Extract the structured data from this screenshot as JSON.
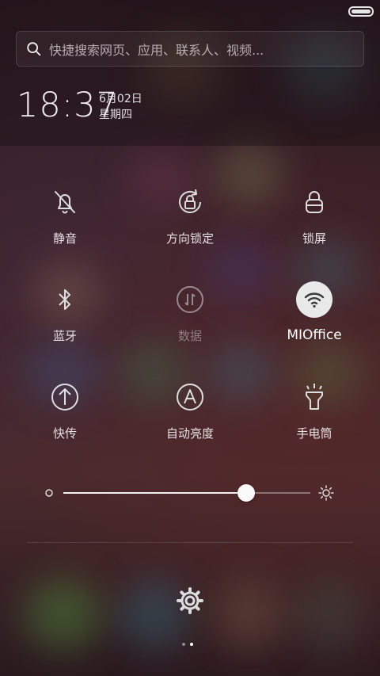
{
  "search": {
    "placeholder": "快捷搜索网页、应用、联系人、视频..."
  },
  "clock": {
    "time": "18:37",
    "date": "6月02日",
    "weekday": "星期四"
  },
  "toggles": [
    {
      "label": "静音",
      "icon": "bell-muted-icon",
      "active": false,
      "dim": false
    },
    {
      "label": "方向锁定",
      "icon": "rotation-lock-icon",
      "active": false,
      "dim": false
    },
    {
      "label": "锁屏",
      "icon": "lock-icon",
      "active": false,
      "dim": false
    },
    {
      "label": "蓝牙",
      "icon": "bluetooth-icon",
      "active": false,
      "dim": false
    },
    {
      "label": "数据",
      "icon": "mobile-data-icon",
      "active": false,
      "dim": true
    },
    {
      "label": "MIOffice",
      "icon": "wifi-icon",
      "active": true,
      "dim": false
    },
    {
      "label": "快传",
      "icon": "quick-transfer-icon",
      "active": false,
      "dim": false
    },
    {
      "label": "自动亮度",
      "icon": "auto-brightness-icon",
      "active": false,
      "dim": false
    },
    {
      "label": "手电筒",
      "icon": "flashlight-icon",
      "active": false,
      "dim": false
    }
  ],
  "brightness": {
    "level": 0.74
  },
  "pager": {
    "pages": 2,
    "current": 2
  },
  "colors": {
    "accent": "#e9e9ea"
  }
}
